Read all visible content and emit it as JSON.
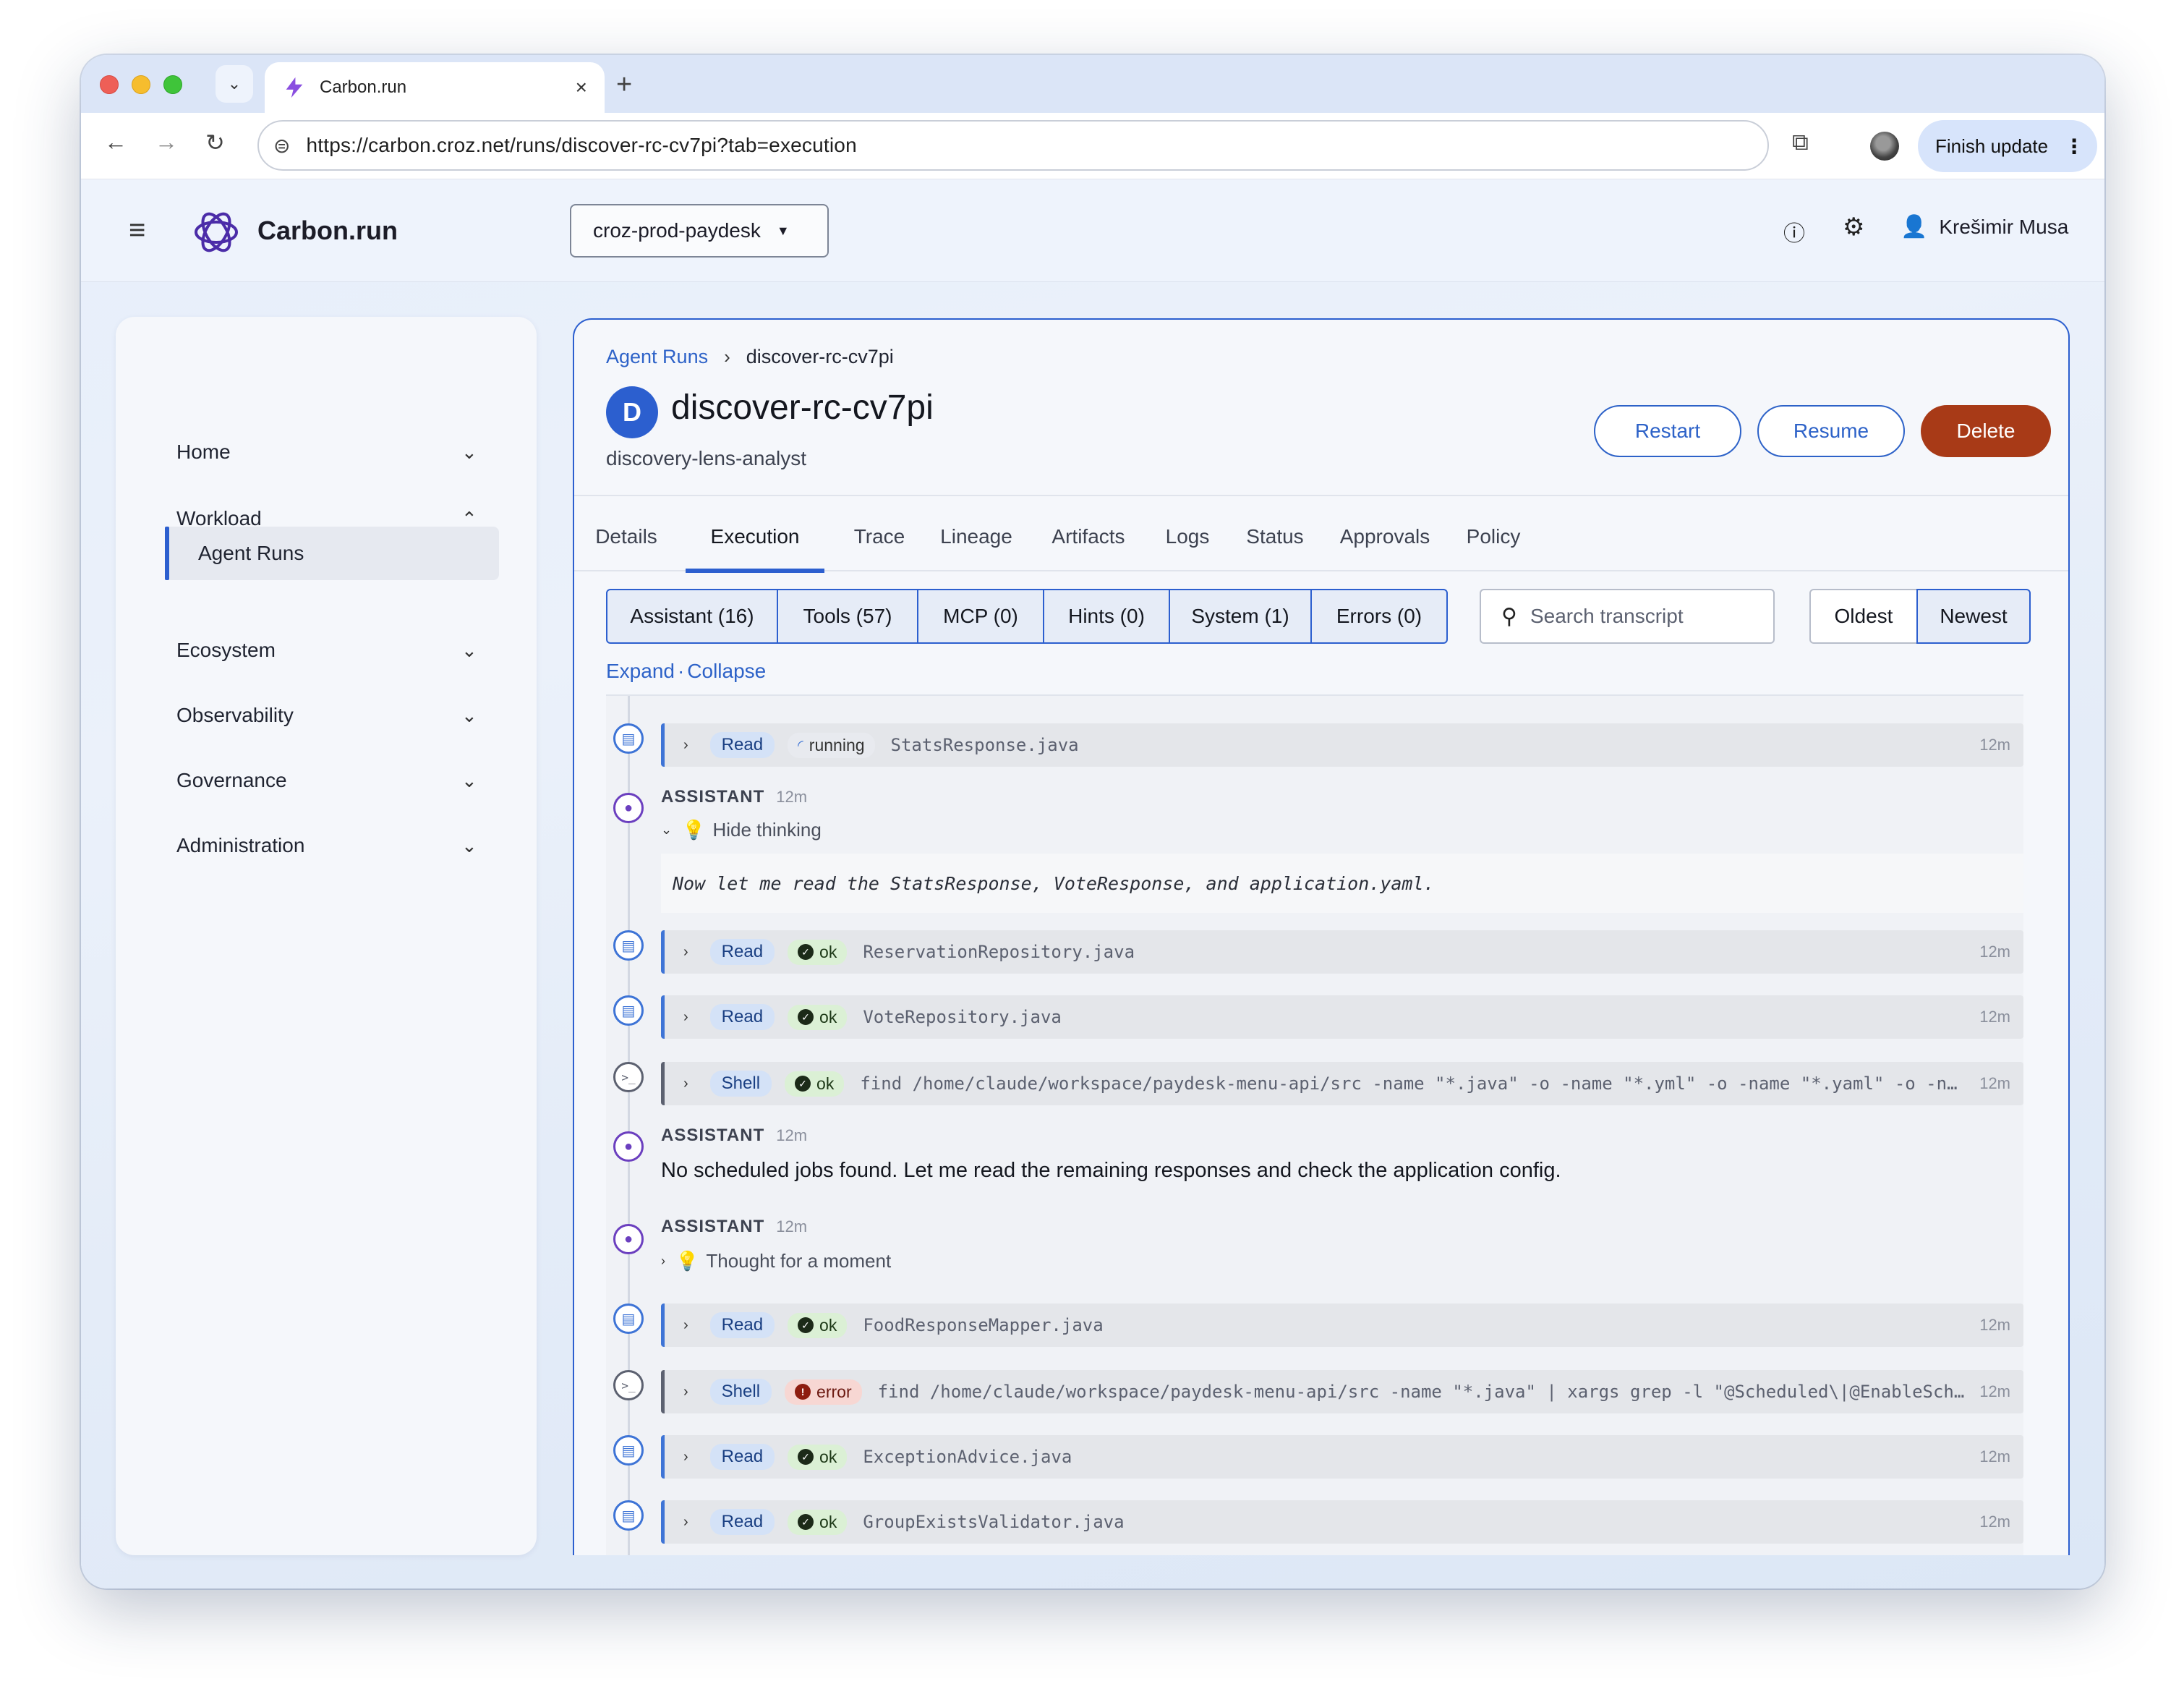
{
  "browser": {
    "tab_title": "Carbon.run",
    "url": "https://carbon.croz.net/runs/discover-rc-cv7pi?tab=execution",
    "finish_update": "Finish update"
  },
  "app": {
    "brand": "Carbon.run",
    "project": "croz-prod-paydesk",
    "user": "Krešimir Musa"
  },
  "sidebar": {
    "items": [
      {
        "label": "Home"
      },
      {
        "label": "Workload"
      },
      {
        "label": "Agent Runs"
      },
      {
        "label": "Ecosystem"
      },
      {
        "label": "Observability"
      },
      {
        "label": "Governance"
      },
      {
        "label": "Administration"
      }
    ]
  },
  "run": {
    "breadcrumb_parent": "Agent Runs",
    "breadcrumb_current": "discover-rc-cv7pi",
    "avatar_letter": "D",
    "title": "discover-rc-cv7pi",
    "subtitle": "discovery-lens-analyst",
    "restart": "Restart",
    "resume": "Resume",
    "delete": "Delete"
  },
  "tabs": [
    "Details",
    "Execution",
    "Trace",
    "Lineage",
    "Artifacts",
    "Logs",
    "Status",
    "Approvals",
    "Policy"
  ],
  "filters": [
    "Assistant (16)",
    "Tools (57)",
    "MCP (0)",
    "Hints (0)",
    "System (1)",
    "Errors (0)"
  ],
  "search": {
    "placeholder": "Search transcript"
  },
  "sort": {
    "oldest": "Oldest",
    "newest": "Newest"
  },
  "expand": {
    "expand": "Expand",
    "separator": "·",
    "collapse": "Collapse"
  },
  "transcript": {
    "rows": [
      {
        "tool": "Read",
        "status": "running",
        "target": "StatsResponse.java",
        "time": "12m"
      },
      {
        "label": "ASSISTANT",
        "time": "12m",
        "toggle": "Hide thinking",
        "thinking": "Now let me read the StatsResponse, VoteResponse, and application.yaml."
      },
      {
        "tool": "Read",
        "status": "ok",
        "target": "ReservationRepository.java",
        "time": "12m"
      },
      {
        "tool": "Read",
        "status": "ok",
        "target": "VoteRepository.java",
        "time": "12m"
      },
      {
        "tool": "Shell",
        "status": "ok",
        "target": "find /home/claude/workspace/paydesk-menu-api/src -name \"*.java\" -o -name \"*.yml\" -o -name \"*.yaml\" -o -name \"*.properties\"",
        "time": "12m"
      },
      {
        "label": "ASSISTANT",
        "time": "12m",
        "message": "No scheduled jobs found. Let me read the remaining responses and check the application config."
      },
      {
        "label": "ASSISTANT",
        "time": "12m",
        "toggle": "Thought for a moment"
      },
      {
        "tool": "Read",
        "status": "ok",
        "target": "FoodResponseMapper.java",
        "time": "12m"
      },
      {
        "tool": "Shell",
        "status": "error",
        "target": "find /home/claude/workspace/paydesk-menu-api/src -name \"*.java\" | xargs grep -l \"@Scheduled\\|@EnableScheduling\"",
        "time": "12m"
      },
      {
        "tool": "Read",
        "status": "ok",
        "target": "ExceptionAdvice.java",
        "time": "12m"
      },
      {
        "tool": "Read",
        "status": "ok",
        "target": "GroupExistsValidator.java",
        "time": "12m"
      }
    ]
  },
  "colors": {
    "accent": "#2c5fcf",
    "delete": "#a83a17",
    "ok_badge": "#dbf0d5",
    "error_badge": "#f7d7d3"
  },
  "icons": [
    "menu-icon",
    "brand-logo-icon",
    "help-icon",
    "gear-icon",
    "user-icon",
    "search-icon",
    "file-icon",
    "assistant-icon",
    "terminal-icon",
    "chevron-down-icon",
    "chevron-up-icon",
    "chevron-right-icon",
    "lightbulb-icon",
    "check-icon",
    "error-icon"
  ]
}
